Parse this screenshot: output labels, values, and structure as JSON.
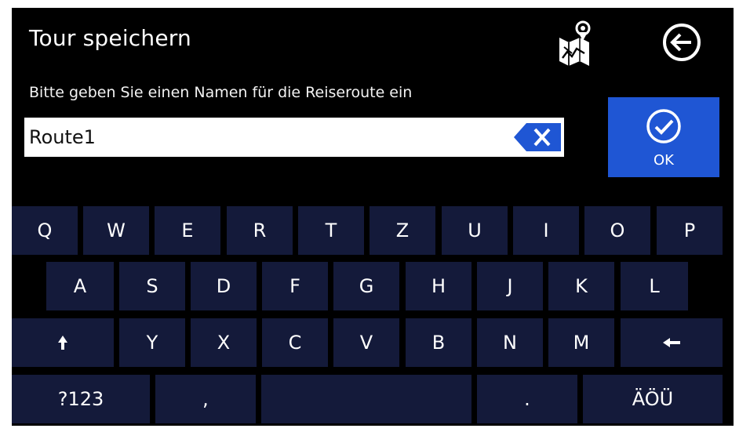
{
  "header": {
    "title": "Tour speichern",
    "map_icon": "map-route-icon",
    "back_icon": "back-arrow-icon"
  },
  "prompt": "Bitte geben Sie einen Namen für die Reiseroute ein",
  "input": {
    "value": "Route1",
    "clear_icon": "clear-backspace-icon"
  },
  "ok_button": {
    "label": "OK",
    "icon": "check-circle-icon"
  },
  "keyboard": {
    "row1": [
      "Q",
      "W",
      "E",
      "R",
      "T",
      "Z",
      "U",
      "I",
      "O",
      "P"
    ],
    "row2": [
      "A",
      "S",
      "D",
      "F",
      "G",
      "H",
      "J",
      "K",
      "L"
    ],
    "row3": [
      "Y",
      "X",
      "C",
      "V",
      "B",
      "N",
      "M"
    ],
    "shift_glyph": "↑",
    "backspace_glyph": "←",
    "symbols_label": "?123",
    "comma_label": ",",
    "period_label": ".",
    "umlaut_label": "ÄÖÜ"
  },
  "colors": {
    "background": "#000000",
    "key": "#141a3a",
    "accent": "#1f56d4",
    "text": "#ffffff"
  }
}
